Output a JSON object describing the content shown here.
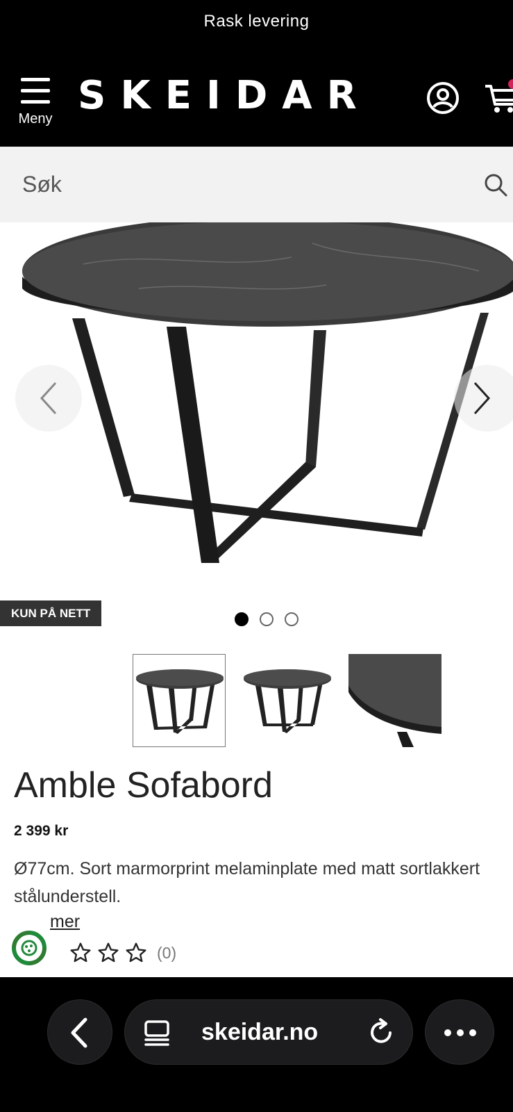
{
  "topbar": {
    "text": "Rask levering"
  },
  "header": {
    "menu_label": "Meny",
    "logo": "SKEIDAR",
    "icons": [
      "menu-icon",
      "account-icon",
      "cart-icon"
    ]
  },
  "search": {
    "placeholder": "Søk",
    "icon": "search-icon"
  },
  "gallery": {
    "badge": "KUN PÅ NETT",
    "slide_count": 3,
    "active_slide": 1,
    "prev_icon": "chevron-left-icon",
    "next_icon": "chevron-right-icon"
  },
  "product": {
    "title": "Amble Sofabord",
    "price": "2 399 kr",
    "description": "Ø77cm. Sort marmorprint melaminplate med matt sortlakkert stålunderstell.",
    "read_more": "mer",
    "rating_count": "(0)",
    "rating_value": 0
  },
  "browser": {
    "url": "skeidar.no",
    "icons": [
      "back-icon",
      "tabs-icon",
      "reload-icon",
      "more-icon"
    ]
  },
  "colors": {
    "header_bg": "#000000",
    "search_bg": "#f2f2f2",
    "badge_bg": "#333333",
    "cart_badge": "#d0245a"
  }
}
